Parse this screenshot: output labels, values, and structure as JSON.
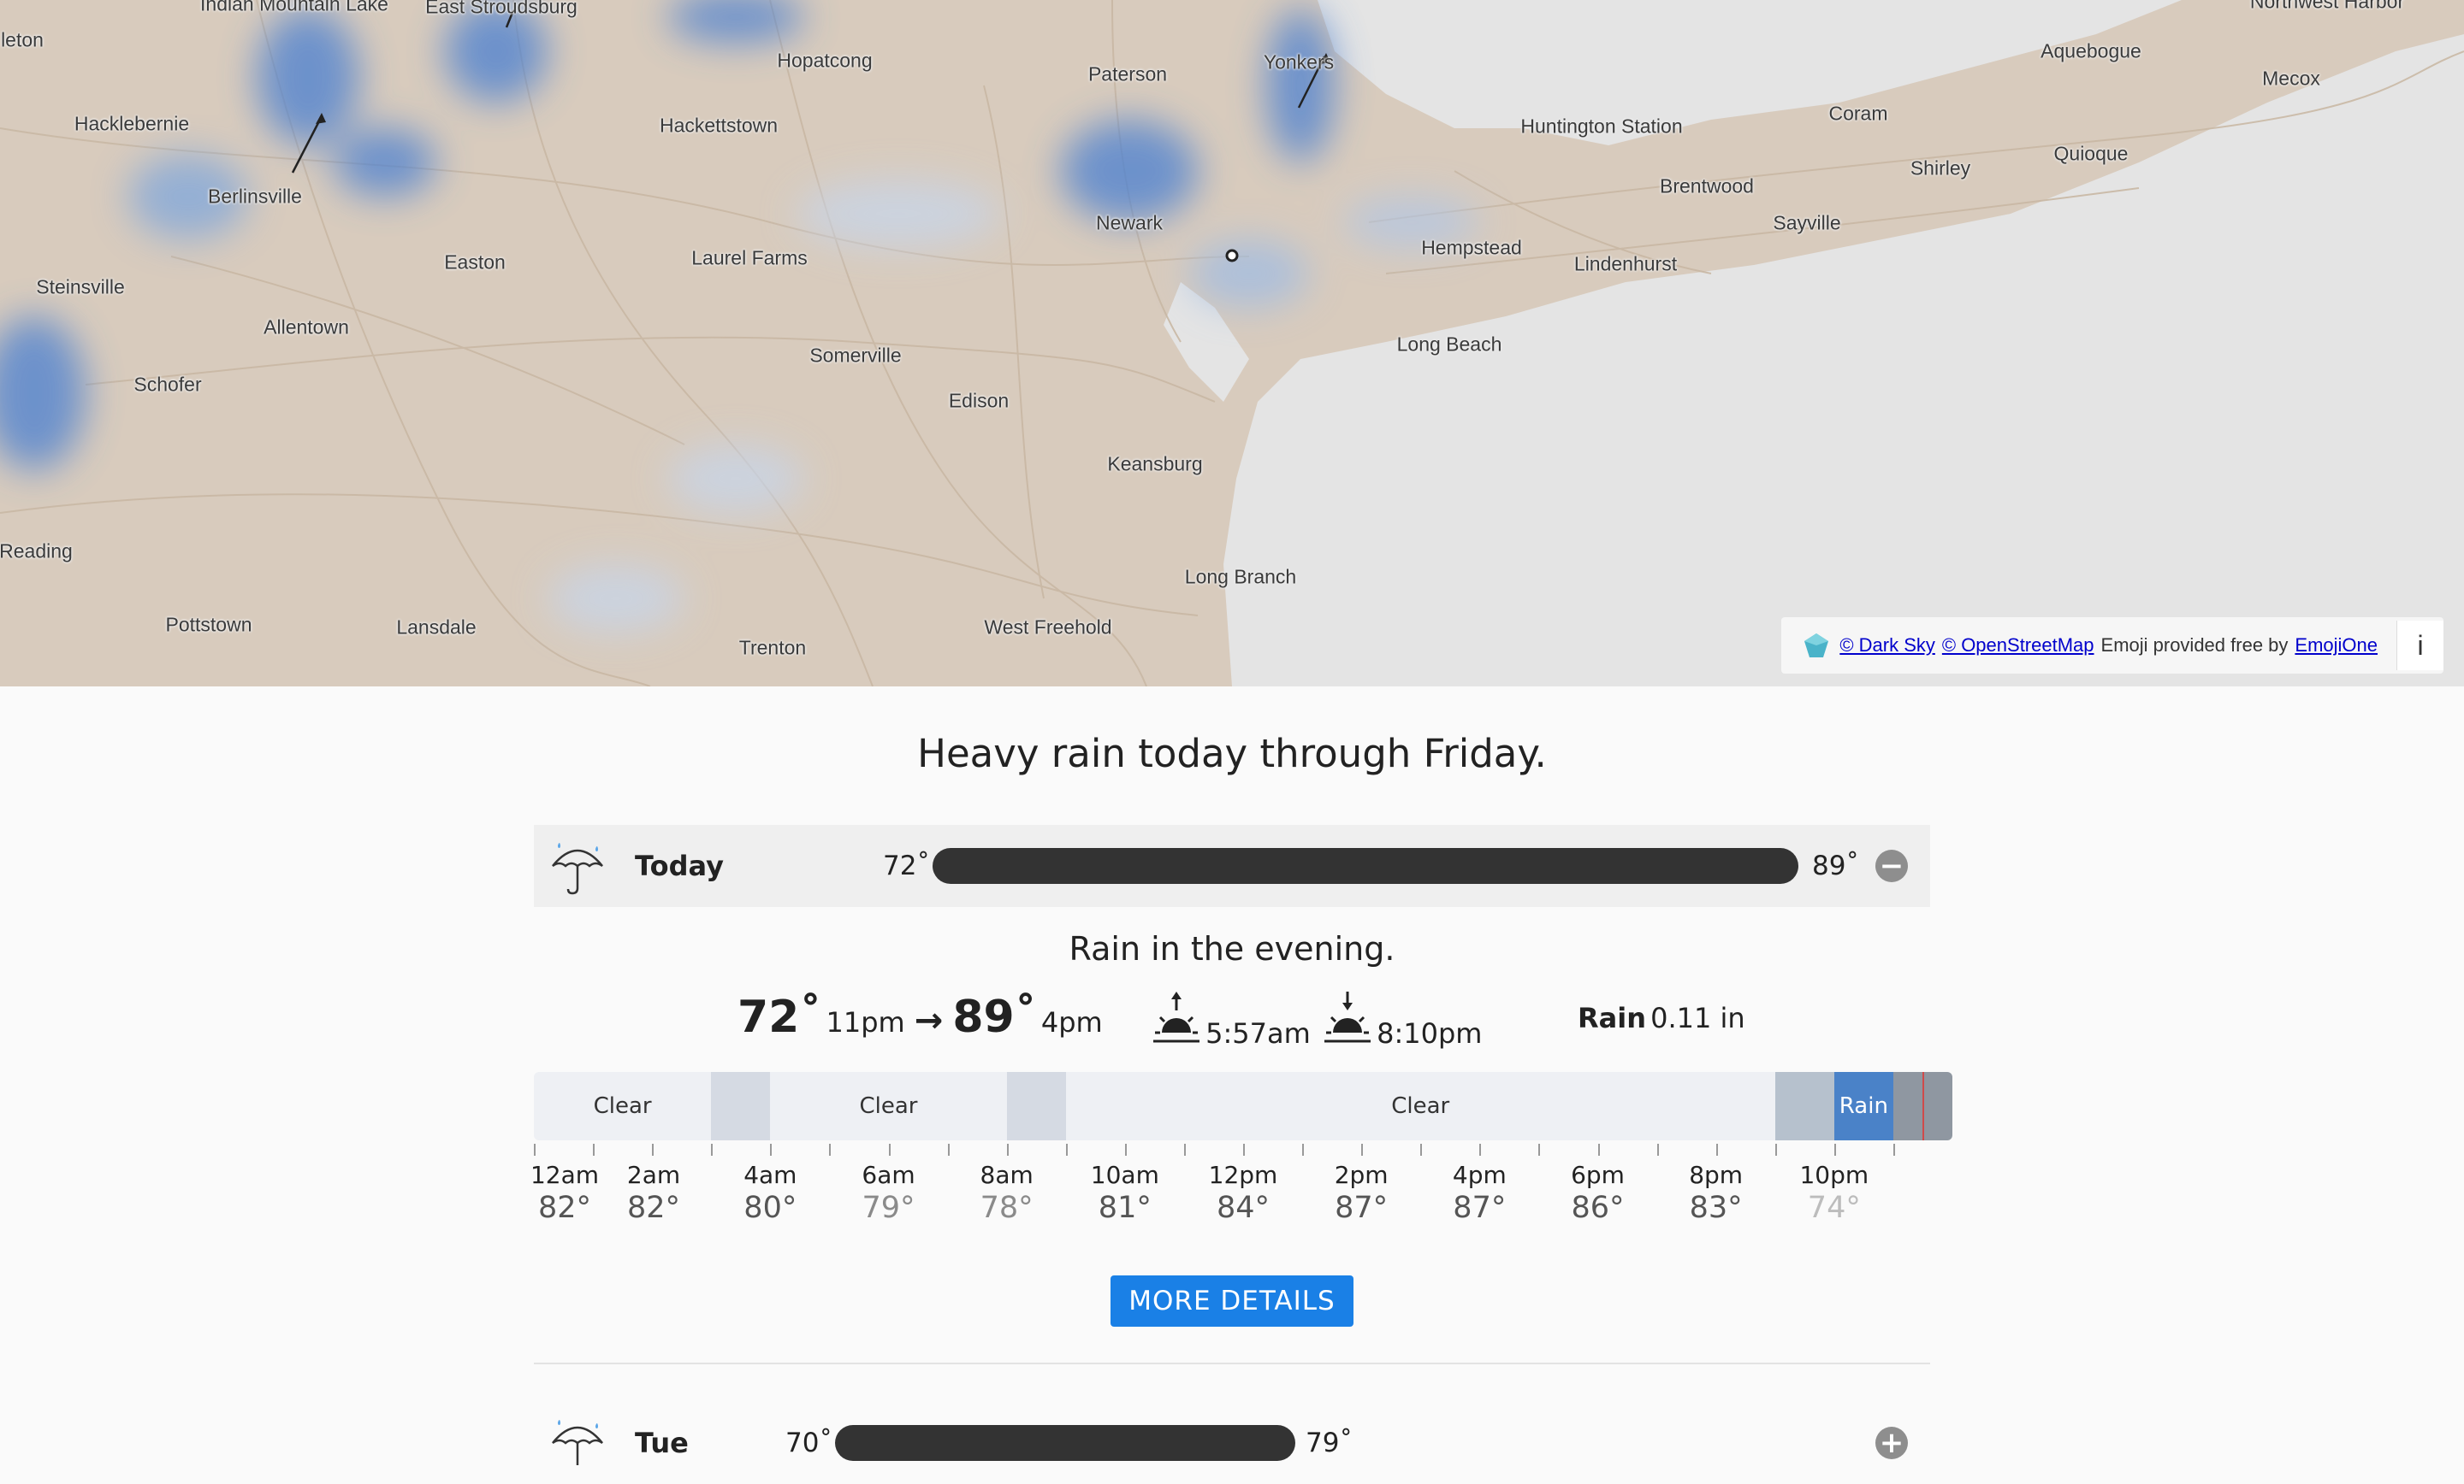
{
  "map": {
    "places": [
      {
        "name": "Indian Mountain Lake"
      },
      {
        "name": "East Stroudsburg"
      },
      {
        "name": "leton"
      },
      {
        "name": "Hopatcong"
      },
      {
        "name": "Paterson"
      },
      {
        "name": "Yonkers"
      },
      {
        "name": "Northwest Harbor"
      },
      {
        "name": "Aquebogue"
      },
      {
        "name": "Mecox"
      },
      {
        "name": "Hacklebernie"
      },
      {
        "name": "Hackettstown"
      },
      {
        "name": "Huntington Station"
      },
      {
        "name": "Coram"
      },
      {
        "name": "Quioque"
      },
      {
        "name": "Shirley"
      },
      {
        "name": "Berlinsville"
      },
      {
        "name": "Brentwood"
      },
      {
        "name": "Newark"
      },
      {
        "name": "Sayville"
      },
      {
        "name": "Hempstead"
      },
      {
        "name": "Easton"
      },
      {
        "name": "Laurel Farms"
      },
      {
        "name": "Lindenhurst"
      },
      {
        "name": "Steinsville"
      },
      {
        "name": "Allentown"
      },
      {
        "name": "Long Beach"
      },
      {
        "name": "Somerville"
      },
      {
        "name": "Schofer"
      },
      {
        "name": "Edison"
      },
      {
        "name": "Keansburg"
      },
      {
        "name": "Reading"
      },
      {
        "name": "Long Branch"
      },
      {
        "name": "Pottstown"
      },
      {
        "name": "Lansdale"
      },
      {
        "name": "Trenton"
      },
      {
        "name": "West Freehold"
      }
    ],
    "attribution": {
      "dark_sky": "© Dark Sky",
      "osm": "© OpenStreetMap",
      "emoji_text": "Emoji provided free by",
      "emojione": "EmojiOne",
      "info": "i"
    }
  },
  "summary": "Heavy rain today through Friday.",
  "today": {
    "label": "Today",
    "icon": "umbrella-rain-icon",
    "low": "72˚",
    "high": "89˚",
    "toggle": "−",
    "summary": "Rain in the evening.",
    "temp_low": "72˚",
    "temp_low_time": "11pm",
    "arrow": "→",
    "temp_high": "89˚",
    "temp_high_time": "4pm",
    "sunrise": "5:57am",
    "sunset": "8:10pm",
    "precip_label": "Rain",
    "precip_value": "0.11 in",
    "timeline": [
      {
        "label": "Clear",
        "hours": 3,
        "color": "#eef0f4"
      },
      {
        "label": "",
        "hours": 1,
        "color": "#d5dae3"
      },
      {
        "label": "Clear",
        "hours": 4,
        "color": "#eef0f4"
      },
      {
        "label": "",
        "hours": 1,
        "color": "#d5dae3"
      },
      {
        "label": "Clear",
        "hours": 12,
        "color": "#eef0f4"
      },
      {
        "label": "",
        "hours": 1,
        "color": "#b6c1cd"
      },
      {
        "label": "Rain",
        "hours": 1,
        "color": "#4a82c8"
      },
      {
        "label": "",
        "hours": 1,
        "color": "#8f97a1"
      }
    ],
    "hours": [
      {
        "time": "12am",
        "temp": "82°"
      },
      {
        "time": "2am",
        "temp": "82°"
      },
      {
        "time": "4am",
        "temp": "80°"
      },
      {
        "time": "6am",
        "temp": "79°"
      },
      {
        "time": "8am",
        "temp": "78°"
      },
      {
        "time": "10am",
        "temp": "81°"
      },
      {
        "time": "12pm",
        "temp": "84°"
      },
      {
        "time": "2pm",
        "temp": "87°"
      },
      {
        "time": "4pm",
        "temp": "87°"
      },
      {
        "time": "6pm",
        "temp": "86°"
      },
      {
        "time": "8pm",
        "temp": "83°"
      },
      {
        "time": "10pm",
        "temp": "74°"
      }
    ],
    "more_button": "MORE DETAILS"
  },
  "tue": {
    "label": "Tue",
    "icon": "umbrella-rain-icon",
    "low": "70˚",
    "high": "79˚",
    "toggle": "+"
  }
}
